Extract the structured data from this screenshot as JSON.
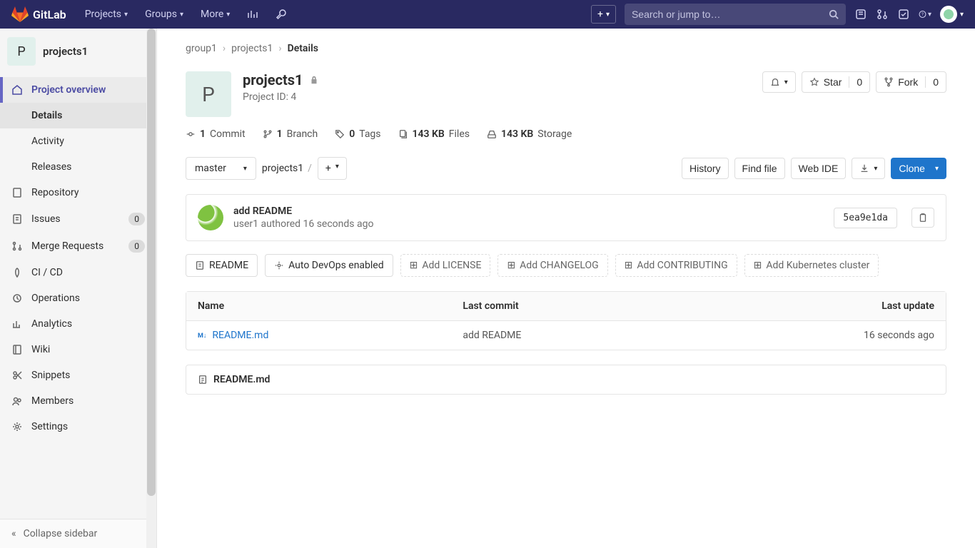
{
  "topnav": {
    "brand": "GitLab",
    "items": [
      "Projects",
      "Groups",
      "More"
    ],
    "search_placeholder": "Search or jump to…"
  },
  "sidebar": {
    "project_initial": "P",
    "project_name": "projects1",
    "overview": "Project overview",
    "sub": [
      "Details",
      "Activity",
      "Releases"
    ],
    "items": [
      {
        "label": "Repository"
      },
      {
        "label": "Issues",
        "count": "0"
      },
      {
        "label": "Merge Requests",
        "count": "0"
      },
      {
        "label": "CI / CD"
      },
      {
        "label": "Operations"
      },
      {
        "label": "Analytics"
      },
      {
        "label": "Wiki"
      },
      {
        "label": "Snippets"
      },
      {
        "label": "Members"
      },
      {
        "label": "Settings"
      }
    ],
    "collapse": "Collapse sidebar"
  },
  "breadcrumb": {
    "a": "group1",
    "b": "projects1",
    "c": "Details"
  },
  "hero": {
    "initial": "P",
    "name": "projects1",
    "pid": "Project ID: 4",
    "star": "Star",
    "star_n": "0",
    "fork": "Fork",
    "fork_n": "0"
  },
  "stats": {
    "commits_n": "1",
    "commits": "Commit",
    "branches_n": "1",
    "branches": "Branch",
    "tags_n": "0",
    "tags": "Tags",
    "files_n": "143 KB",
    "files": "Files",
    "storage_n": "143 KB",
    "storage": "Storage"
  },
  "controls": {
    "branch": "master",
    "path": "projects1",
    "history": "History",
    "find": "Find file",
    "ide": "Web IDE",
    "clone": "Clone"
  },
  "commit": {
    "title": "add README",
    "author": "user1",
    "authored": "authored",
    "time": "16 seconds ago",
    "sha": "5ea9e1da"
  },
  "chips": {
    "readme": "README",
    "autodevops": "Auto DevOps enabled",
    "license": "Add LICENSE",
    "changelog": "Add CHANGELOG",
    "contributing": "Add CONTRIBUTING",
    "k8s": "Add Kubernetes cluster"
  },
  "table": {
    "h_name": "Name",
    "h_commit": "Last commit",
    "h_update": "Last update",
    "rows": [
      {
        "name": "README.md",
        "commit": "add README",
        "update": "16 seconds ago"
      }
    ]
  },
  "readme_panel": "README.md"
}
